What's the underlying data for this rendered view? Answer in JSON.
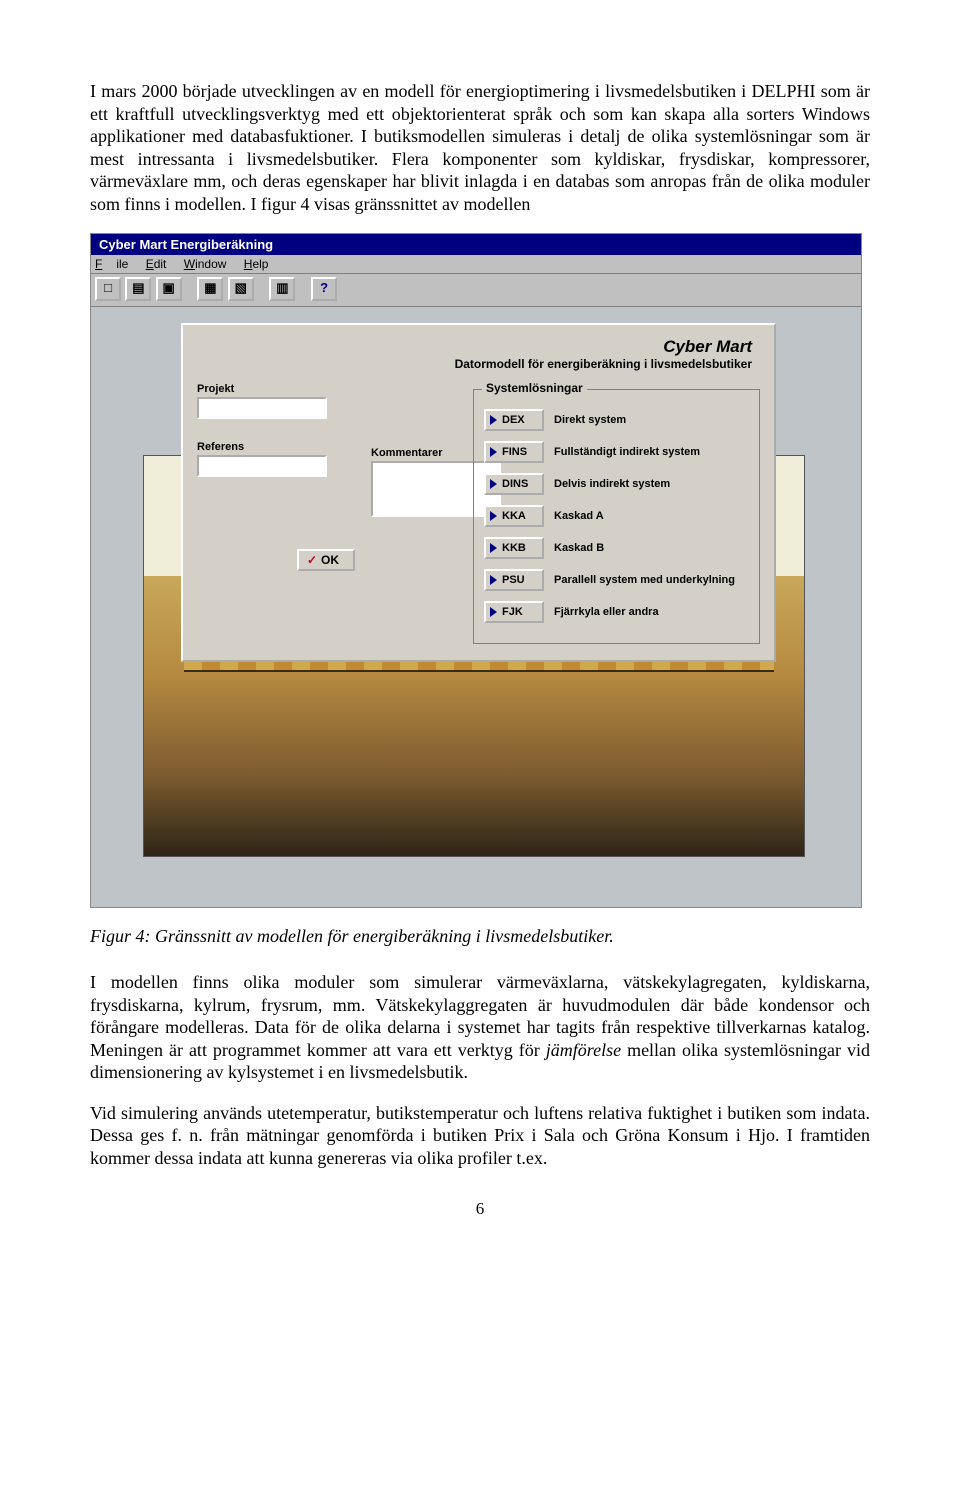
{
  "para1": "I mars 2000 började utvecklingen av en modell för energioptimering i livsmedelsbutiken i DELPHI som är ett kraftfull utvecklingsverktyg med ett objektorienterat språk och som kan skapa alla sorters Windows applikationer med databasfuktioner. I butiksmodellen simuleras i detalj de olika systemlösningar som är mest intressanta i livsmedelsbutiker. Flera komponenter som kyldiskar, frysdiskar, kompressorer, värmeväxlare mm, och deras egenskaper har blivit inlagda i en databas som anropas från de olika moduler som finns i modellen. I figur 4 visas gränssnittet av modellen",
  "figCaption": "Figur 4: Gränssnitt av modellen för energiberäkning i livsmedelsbutiker.",
  "para2": "I modellen finns olika moduler som simulerar värmeväxlarna, vätskekylagregaten, kyldiskarna, frysdiskarna, kylrum, frysrum, mm. Vätskekylaggregaten är huvudmodulen där både kondensor och förångare modelleras. Data för de olika delarna i systemet har tagits från respektive tillverkarnas katalog. Meningen är att programmet kommer att vara ett verktyg för jämförelse mellan olika systemlösningar vid dimensionering av kylsystemet i en livsmedelsbutik.",
  "para3": "Vid simulering används utetemperatur, butikstemperatur och luftens relativa fuktighet i butiken som indata. Dessa ges f. n. från mätningar genomförda i butiken Prix i Sala och Gröna Konsum i Hjo. I framtiden kommer dessa indata att kunna genereras via olika profiler t.ex.",
  "pageNumber": "6",
  "app": {
    "title": "Cyber Mart   Energiberäkning",
    "menu": {
      "file": "File",
      "edit": "Edit",
      "window": "Window",
      "help": "Help"
    },
    "toolbar": {
      "new": "□",
      "open": "▤",
      "save": "▣",
      "db1": "▦",
      "db2": "▧",
      "grid": "▥",
      "help": "?"
    },
    "form": {
      "appTitle": "Cyber Mart",
      "appSubtitle": "Datormodell för energiberäkning i livsmedelsbutiker",
      "projektLabel": "Projekt",
      "projekt": "",
      "kommentarerLabel": "Kommentarer",
      "kommentarer": "",
      "referensLabel": "Referens",
      "referens": "",
      "okLabel": "OK",
      "groupTitle": "Systemlösningar",
      "systems": [
        {
          "code": "DEX",
          "label": "Direkt system"
        },
        {
          "code": "FINS",
          "label": "Fullständigt indirekt system"
        },
        {
          "code": "DINS",
          "label": "Delvis indirekt system"
        },
        {
          "code": "KKA",
          "label": "Kaskad A"
        },
        {
          "code": "KKB",
          "label": "Kaskad B"
        },
        {
          "code": "PSU",
          "label": "Parallell system med underkylning"
        },
        {
          "code": "FJK",
          "label": "Fjärrkyla eller andra"
        }
      ]
    }
  }
}
